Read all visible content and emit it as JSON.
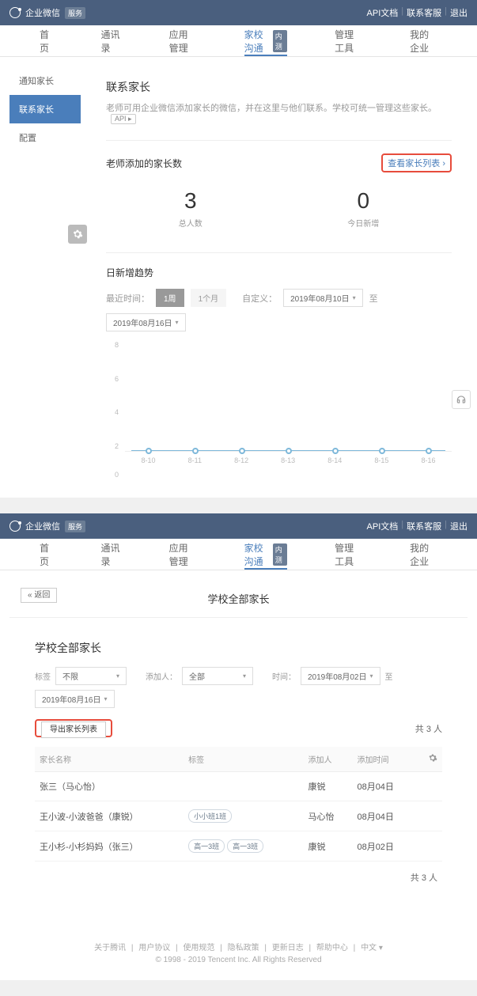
{
  "topbar": {
    "brand": "企业微信",
    "badge": "服务",
    "api_doc": "API文档",
    "support": "联系客服",
    "logout": "退出"
  },
  "nav": {
    "items": [
      "首页",
      "通讯录",
      "应用管理",
      "家校沟通",
      "管理工具",
      "我的企业"
    ],
    "active_index": 3,
    "badge_text": "内测"
  },
  "sidebar": {
    "items": [
      "通知家长",
      "联系家长",
      "配置"
    ],
    "active_index": 1
  },
  "page1": {
    "title": "联系家长",
    "desc": "老师可用企业微信添加家长的微信，并在这里与他们联系。学校可统一管理这些家长。",
    "api_badge": "API ▸",
    "section_title": "老师添加的家长数",
    "view_list": "查看家长列表 ›",
    "stats": [
      {
        "num": "3",
        "label": "总人数"
      },
      {
        "num": "0",
        "label": "今日新增"
      }
    ],
    "trend_title": "日新增趋势",
    "recent_label": "最近时间：",
    "tab_week": "1周",
    "tab_month": "1个月",
    "custom_label": "自定义：",
    "date_from": "2019年08月10日",
    "date_to_label": "至",
    "date_to": "2019年08月16日"
  },
  "chart_data": {
    "type": "line",
    "categories": [
      "8-10",
      "8-11",
      "8-12",
      "8-13",
      "8-14",
      "8-15",
      "8-16"
    ],
    "values": [
      0,
      0,
      0,
      0,
      0,
      0,
      0
    ],
    "y_ticks": [
      0,
      2,
      4,
      6,
      8
    ],
    "ylim": [
      0,
      8
    ],
    "title": "日新增趋势"
  },
  "page2": {
    "header": "学校全部家长",
    "back": "« 返回",
    "title": "学校全部家长",
    "tag_label": "标签",
    "tag_value": "不限",
    "adder_label": "添加人：",
    "adder_value": "全部",
    "time_label": "时间：",
    "date_from": "2019年08月02日",
    "to": "至",
    "date_to": "2019年08月16日",
    "export": "导出家长列表",
    "count": "共 3 人",
    "columns": [
      "家长名称",
      "标签",
      "添加人",
      "添加时间"
    ],
    "rows": [
      {
        "name": "张三（马心怡）",
        "tags": [],
        "adder": "康锐",
        "time": "08月04日"
      },
      {
        "name": "王小波-小波爸爸（康锐）",
        "tags": [
          "小小班1班"
        ],
        "adder": "马心怡",
        "time": "08月04日"
      },
      {
        "name": "王小杉-小杉妈妈（张三）",
        "tags": [
          "高一3班",
          "高一3班"
        ],
        "adder": "康锐",
        "time": "08月02日"
      }
    ],
    "footer_count": "共 3 人"
  },
  "footer": {
    "links": [
      "关于腾讯",
      "用户协议",
      "使用规范",
      "隐私政策",
      "更新日志",
      "帮助中心",
      "中文 ▾"
    ],
    "copyright": "© 1998 - 2019 Tencent Inc. All Rights Reserved"
  }
}
